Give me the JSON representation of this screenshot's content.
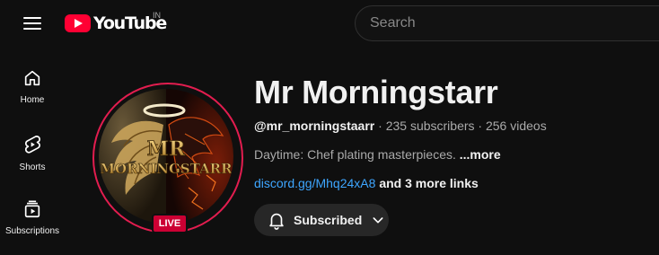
{
  "header": {
    "logo_text": "YouTube",
    "country_code": "IN",
    "search_placeholder": "Search"
  },
  "sidebar": {
    "items": [
      {
        "label": "Home",
        "icon": "home-icon"
      },
      {
        "label": "Shorts",
        "icon": "shorts-icon"
      },
      {
        "label": "Subscriptions",
        "icon": "subscriptions-icon"
      }
    ]
  },
  "channel": {
    "name": "Mr Morningstarr",
    "handle": "@mr_morningstaarr",
    "subscribers": "235 subscribers",
    "videos": "256 videos",
    "separator": "·",
    "description": "Daytime: Chef plating masterpieces.",
    "more_label": "...more",
    "link": "discord.gg/Mhq24xA8",
    "more_links": "and 3 more links",
    "live_badge": "LIVE",
    "avatar_text_top": "MR",
    "avatar_text_bottom": "MORNINGSTARR",
    "subscribe_label": "Subscribed"
  },
  "colors": {
    "background": "#0f0f0f",
    "brand_red": "#ff0033",
    "link_blue": "#3ea6ff",
    "live_red": "#cc0033",
    "avatar_ring": "#e21d4f"
  }
}
